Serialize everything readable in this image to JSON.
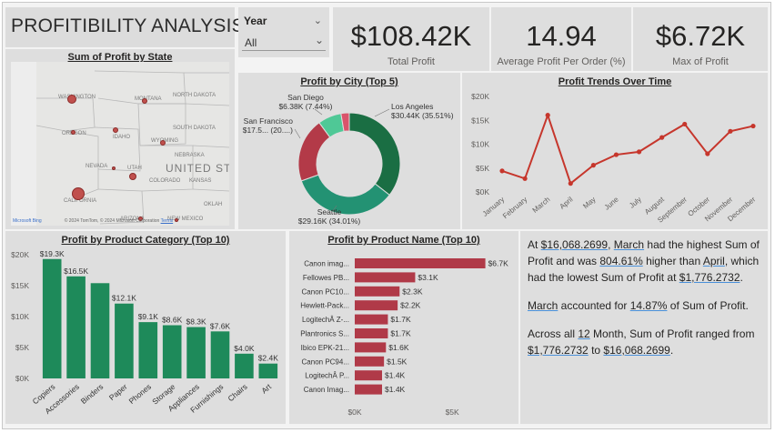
{
  "page": {
    "title": "PROFITIBILITY ANALYSIS"
  },
  "slicer": {
    "label": "Year",
    "value": "All"
  },
  "kpis": [
    {
      "value": "$108.42K",
      "label": "Total Profit"
    },
    {
      "value": "14.94",
      "label": "Average Profit Per Order (%)"
    },
    {
      "value": "$6.72K",
      "label": "Max of Profit"
    }
  ],
  "map": {
    "title": "Sum of Profit by State",
    "footer": "© 2024 TomTom, © 2024 Microsoft Corporation",
    "terms": "Terms",
    "bing": "Microsoft Bing",
    "labels": [
      "WASHINGTON",
      "MONTANA",
      "NORTH DAKOTA",
      "OREGON",
      "IDAHO",
      "WYOMING",
      "SOUTH DAKOTA",
      "NEBRASKA",
      "NEVADA",
      "UTAH",
      "COLORADO",
      "KANSAS",
      "CALIFORNIA",
      "ARIZONA",
      "NEW MEXICO",
      "OKLAH",
      "UNITED ST"
    ],
    "colors": {
      "bubble": "#c0504d"
    }
  },
  "donut": {
    "title": "Profit by City (Top 5)",
    "slices": [
      {
        "name": "Los Angeles",
        "label": "$30.44K (35.51%)",
        "value": 30.44,
        "color": "#1a6e43"
      },
      {
        "name": "Seattle",
        "label": "$29.16K (34.01%)",
        "value": 29.16,
        "color": "#239273"
      },
      {
        "name": "San Francisco",
        "label": "$17.5... (20....)",
        "value": 17.5,
        "color": "#b33a48"
      },
      {
        "name": "San Diego",
        "label": "$6.38K (7.44%)",
        "value": 6.38,
        "color": "#4fc896"
      },
      {
        "name": "",
        "label": "",
        "value": 2.25,
        "color": "#d9546b"
      }
    ]
  },
  "trend": {
    "title": "Profit Trends Over Time",
    "color": "#c6362c",
    "chart_data": {
      "type": "line",
      "x": [
        "January",
        "February",
        "March",
        "April",
        "May",
        "June",
        "July",
        "August",
        "September",
        "October",
        "November",
        "December"
      ],
      "values": [
        4400,
        2800,
        16068.27,
        1776.27,
        5600,
        7800,
        8400,
        11400,
        14200,
        8000,
        12700,
        13800
      ],
      "yticks": [
        "$0K",
        "$5K",
        "$10K",
        "$15K",
        "$20K"
      ],
      "ylim": [
        0,
        20000
      ]
    }
  },
  "category": {
    "title": "Profit by Product Category (Top 10)",
    "color": "#1e8a5a",
    "chart_data": {
      "type": "bar",
      "categories": [
        "Copiers",
        "Accessories",
        "Binders",
        "Paper",
        "Phones",
        "Storage",
        "Appliances",
        "Furnishings",
        "Chairs",
        "Art"
      ],
      "values": [
        19.3,
        16.5,
        15.4,
        12.1,
        9.1,
        8.6,
        8.3,
        7.6,
        4.0,
        2.4
      ],
      "labels": [
        "$19.3K",
        "$16.5K",
        "",
        "$12.1K",
        "$9.1K",
        "$8.6K",
        "$8.3K",
        "$7.6K",
        "$4.0K",
        "$2.4K"
      ],
      "yticks": [
        "$0K",
        "$5K",
        "$10K",
        "$15K",
        "$20K"
      ],
      "ylim": [
        0,
        20
      ]
    }
  },
  "product": {
    "title": "Profit by Product Name (Top 10)",
    "color": "#b03a48",
    "chart_data": {
      "type": "bar",
      "categories": [
        "Canon imag...",
        "Fellowes PB...",
        "Canon PC10...",
        "Hewlett-Pack...",
        "LogitechÂ Z-...",
        "Plantronics S...",
        "Ibico EPK-21...",
        "Canon PC94...",
        "LogitechÂ P...",
        "Canon Imag..."
      ],
      "values": [
        6.7,
        3.1,
        2.3,
        2.2,
        1.7,
        1.7,
        1.6,
        1.5,
        1.4,
        1.4
      ],
      "labels": [
        "$6.7K",
        "$3.1K",
        "$2.3K",
        "$2.2K",
        "$1.7K",
        "$1.7K",
        "$1.6K",
        "$1.5K",
        "$1.4K",
        "$1.4K"
      ],
      "xticks": [
        "$0K",
        "$5K"
      ],
      "xlim": [
        0,
        7
      ]
    }
  },
  "insights": {
    "p1": [
      "At ",
      "$16,068.2699",
      ", ",
      "March",
      " had the highest Sum of Profit and was ",
      "804.61%",
      " higher than ",
      "April",
      ", which had the lowest Sum of Profit at ",
      "$1,776.2732",
      "."
    ],
    "p2": [
      "March",
      " accounted for ",
      "14.87%",
      " of Sum of Profit."
    ],
    "p3": [
      "Across all ",
      "12",
      " Month, Sum of Profit ranged from ",
      "$1,776.2732",
      " to ",
      "$16,068.2699",
      "."
    ]
  }
}
